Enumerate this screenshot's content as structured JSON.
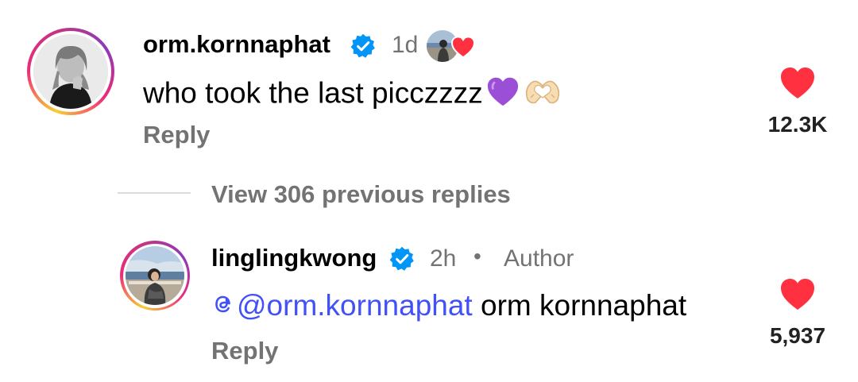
{
  "comment": {
    "username": "orm.kornnaphat",
    "time": "1d",
    "text": "who took the last picczzzz",
    "reply_label": "Reply",
    "like_count": "12.3K"
  },
  "view_replies": {
    "label": "View 306 previous replies"
  },
  "reply": {
    "username": "linglingkwong",
    "time": "2h",
    "separator": "•",
    "badge": "Author",
    "mention": "@orm.kornnaphat",
    "text": "orm kornnaphat",
    "reply_label": "Reply",
    "like_count": "5,937"
  },
  "colors": {
    "heart": "#ff3040",
    "verified": "#0095f6",
    "mention": "#4150f7",
    "muted": "#737373"
  },
  "icons": {
    "verified": "verified-badge-icon",
    "like": "heart-icon",
    "purple_heart": "purple-heart-emoji",
    "heart_hands": "heart-hands-emoji",
    "threads": "threads-icon"
  }
}
